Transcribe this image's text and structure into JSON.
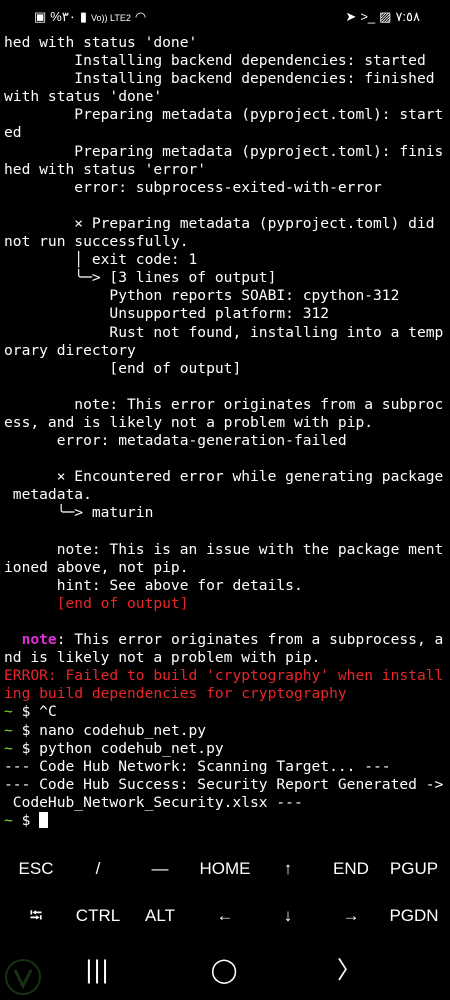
{
  "status_bar": {
    "left_text": "%٣٠",
    "left_icons": [
      "notification-icon",
      "signal-icon",
      "volte-signal-icon",
      "wifi-icon"
    ],
    "volte_label": "Vo)) LTE2",
    "right_icons": [
      "send-icon",
      "terminal-icon",
      "gallery-icon"
    ],
    "time": "٧:٥٨"
  },
  "terminal": {
    "lines": [
      {
        "segments": [
          {
            "text": "hed with status 'done'",
            "color": "white"
          }
        ]
      },
      {
        "segments": [
          {
            "text": "        Installing backend dependencies: started",
            "color": "white"
          }
        ]
      },
      {
        "segments": [
          {
            "text": "        Installing backend dependencies: finished",
            "color": "white"
          }
        ]
      },
      {
        "segments": [
          {
            "text": "with status 'done'",
            "color": "white"
          }
        ]
      },
      {
        "segments": [
          {
            "text": "        Preparing metadata (pyproject.toml): start",
            "color": "white"
          }
        ]
      },
      {
        "segments": [
          {
            "text": "ed",
            "color": "white"
          }
        ]
      },
      {
        "segments": [
          {
            "text": "        Preparing metadata (pyproject.toml): finis",
            "color": "white"
          }
        ]
      },
      {
        "segments": [
          {
            "text": "hed with status 'error'",
            "color": "white"
          }
        ]
      },
      {
        "segments": [
          {
            "text": "        error: subprocess-exited-with-error",
            "color": "white"
          }
        ]
      },
      {
        "segments": [
          {
            "text": "",
            "color": "white"
          }
        ]
      },
      {
        "segments": [
          {
            "text": "        × Preparing metadata (pyproject.toml) did",
            "color": "white"
          }
        ]
      },
      {
        "segments": [
          {
            "text": "not run successfully.",
            "color": "white"
          }
        ]
      },
      {
        "segments": [
          {
            "text": "        │ exit code: 1",
            "color": "white"
          }
        ]
      },
      {
        "segments": [
          {
            "text": "        ╰─> [3 lines of output]",
            "color": "white"
          }
        ]
      },
      {
        "segments": [
          {
            "text": "            Python reports SOABI: cpython-312",
            "color": "white"
          }
        ]
      },
      {
        "segments": [
          {
            "text": "            Unsupported platform: 312",
            "color": "white"
          }
        ]
      },
      {
        "segments": [
          {
            "text": "            Rust not found, installing into a temp",
            "color": "white"
          }
        ]
      },
      {
        "segments": [
          {
            "text": "orary directory",
            "color": "white"
          }
        ]
      },
      {
        "segments": [
          {
            "text": "            [end of output]",
            "color": "white"
          }
        ]
      },
      {
        "segments": [
          {
            "text": "",
            "color": "white"
          }
        ]
      },
      {
        "segments": [
          {
            "text": "        note: This error originates from a subproc",
            "color": "white"
          }
        ]
      },
      {
        "segments": [
          {
            "text": "ess, and is likely not a problem with pip.",
            "color": "white"
          }
        ]
      },
      {
        "segments": [
          {
            "text": "      error: metadata-generation-failed",
            "color": "white"
          }
        ]
      },
      {
        "segments": [
          {
            "text": "",
            "color": "white"
          }
        ]
      },
      {
        "segments": [
          {
            "text": "      × Encountered error while generating package",
            "color": "white"
          }
        ]
      },
      {
        "segments": [
          {
            "text": " metadata.",
            "color": "white"
          }
        ]
      },
      {
        "segments": [
          {
            "text": "      ╰─> maturin",
            "color": "white"
          }
        ]
      },
      {
        "segments": [
          {
            "text": "",
            "color": "white"
          }
        ]
      },
      {
        "segments": [
          {
            "text": "      note: This is an issue with the package ment",
            "color": "white"
          }
        ]
      },
      {
        "segments": [
          {
            "text": "ioned above, not pip.",
            "color": "white"
          }
        ]
      },
      {
        "segments": [
          {
            "text": "      hint: See above for details.",
            "color": "white"
          }
        ]
      },
      {
        "segments": [
          {
            "text": "      [end of output]",
            "color": "red"
          }
        ]
      },
      {
        "segments": [
          {
            "text": "",
            "color": "white"
          }
        ]
      },
      {
        "segments": [
          {
            "text": "  ",
            "color": "white"
          },
          {
            "text": "note",
            "color": "magenta"
          },
          {
            "text": ": This error originates from a subprocess, a",
            "color": "white"
          }
        ]
      },
      {
        "segments": [
          {
            "text": "nd is likely not a problem with pip.",
            "color": "white"
          }
        ]
      },
      {
        "segments": [
          {
            "text": "ERROR: Failed to build 'cryptography' when install",
            "color": "red"
          }
        ]
      },
      {
        "segments": [
          {
            "text": "ing build dependencies for cryptography",
            "color": "red"
          }
        ]
      },
      {
        "segments": [
          {
            "text": "~",
            "color": "green"
          },
          {
            "text": " $ ^C",
            "color": "white"
          }
        ]
      },
      {
        "segments": [
          {
            "text": "~",
            "color": "green"
          },
          {
            "text": " $ nano codehub_net.py",
            "color": "white"
          }
        ]
      },
      {
        "segments": [
          {
            "text": "~",
            "color": "green"
          },
          {
            "text": " $ python codehub_net.py",
            "color": "white"
          }
        ]
      },
      {
        "segments": [
          {
            "text": "--- Code Hub Network: Scanning Target... ---",
            "color": "white"
          }
        ]
      },
      {
        "segments": [
          {
            "text": "--- Code Hub Success: Security Report Generated ->",
            "color": "white"
          }
        ]
      },
      {
        "segments": [
          {
            "text": " CodeHub_Network_Security.xlsx ---",
            "color": "white"
          }
        ]
      },
      {
        "segments": [
          {
            "text": "~",
            "color": "green"
          },
          {
            "text": " $ ",
            "color": "white"
          }
        ],
        "cursor": true
      }
    ]
  },
  "extra_keys": {
    "row1": [
      "ESC",
      "/",
      "—",
      "HOME",
      "↑",
      "END",
      "PGUP"
    ],
    "row2": [
      "⭾",
      "CTRL",
      "ALT",
      "←",
      "↓",
      "→",
      "PGDN"
    ]
  },
  "navigation": {
    "recents_icon": "|||",
    "home_icon": "◯",
    "back_icon": "〉"
  },
  "colors": {
    "background": "#000000",
    "prompt": "#7fdc2e",
    "error": "#e8262a",
    "note": "#e12fd9",
    "text": "#ffffff"
  }
}
